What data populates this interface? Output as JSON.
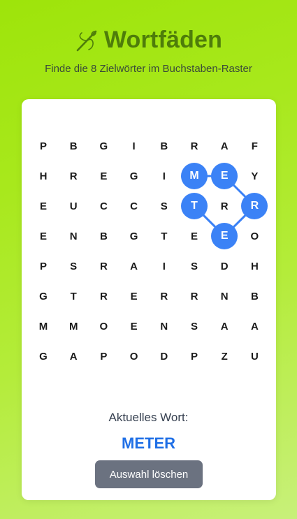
{
  "header": {
    "icon": "needle-thread-icon",
    "title": "Wortfäden",
    "subtitle": "Finde die 8 Zielwörter im Buchstaben-Raster"
  },
  "colors": {
    "accent": "#3b82f6",
    "title": "#4e7d0a",
    "button": "#6b7280"
  },
  "grid": {
    "rows": [
      [
        "P",
        "B",
        "G",
        "I",
        "B",
        "R",
        "A",
        "F"
      ],
      [
        "H",
        "R",
        "E",
        "G",
        "I",
        "M",
        "E",
        "Y"
      ],
      [
        "E",
        "U",
        "C",
        "C",
        "S",
        "T",
        "R",
        "R"
      ],
      [
        "E",
        "N",
        "B",
        "G",
        "T",
        "E",
        "E",
        "O"
      ],
      [
        "P",
        "S",
        "R",
        "A",
        "I",
        "S",
        "D",
        "H"
      ],
      [
        "G",
        "T",
        "R",
        "E",
        "R",
        "R",
        "N",
        "B"
      ],
      [
        "M",
        "M",
        "O",
        "E",
        "N",
        "S",
        "A",
        "A"
      ],
      [
        "G",
        "A",
        "P",
        "O",
        "D",
        "P",
        "Z",
        "U"
      ]
    ],
    "selection_path": [
      [
        1,
        5
      ],
      [
        1,
        6
      ],
      [
        2,
        7
      ],
      [
        3,
        6
      ],
      [
        2,
        5
      ]
    ]
  },
  "status": {
    "current_label": "Aktuelles Wort:",
    "current_word": "METER"
  },
  "controls": {
    "clear_label": "Auswahl löschen"
  }
}
